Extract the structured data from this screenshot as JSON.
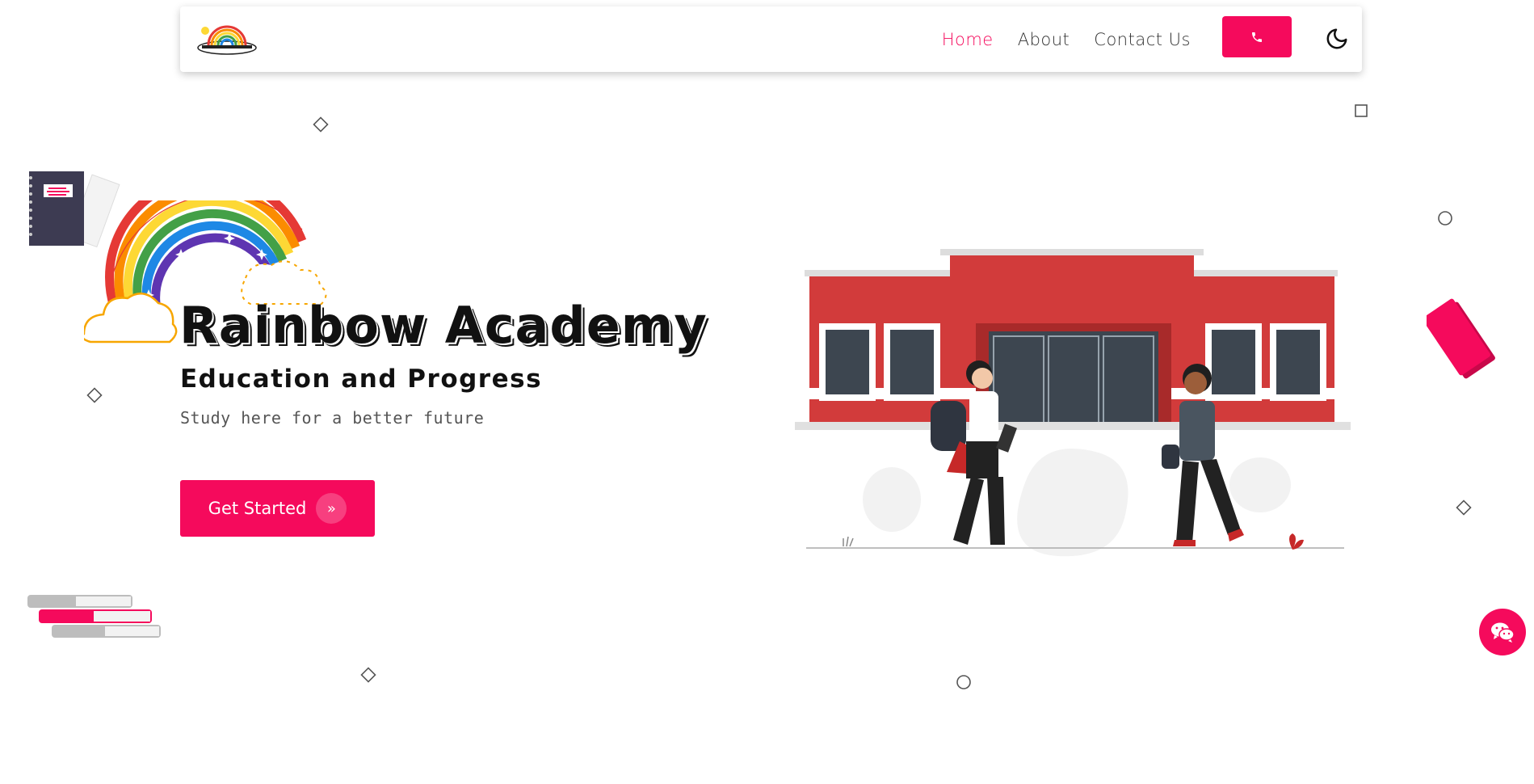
{
  "brand": {
    "name": "Rainbow Academy",
    "logo_icon": "rainbow-logo-icon"
  },
  "nav": {
    "items": [
      {
        "label": "Home",
        "active": true
      },
      {
        "label": "About",
        "active": false
      },
      {
        "label": "Contact Us",
        "active": false
      }
    ],
    "call_icon": "phone-icon",
    "theme_icon": "moon-icon"
  },
  "hero": {
    "title": "Rainbow Academy",
    "subtitle": "Education and Progress",
    "text": "Study here for a better future",
    "cta_label": "Get Started",
    "cta_icon": "double-chevron-right-icon"
  },
  "chat": {
    "icon": "wechat-icon"
  },
  "colors": {
    "accent": "#f50a5c",
    "text": "#111111",
    "muted": "#555555"
  }
}
